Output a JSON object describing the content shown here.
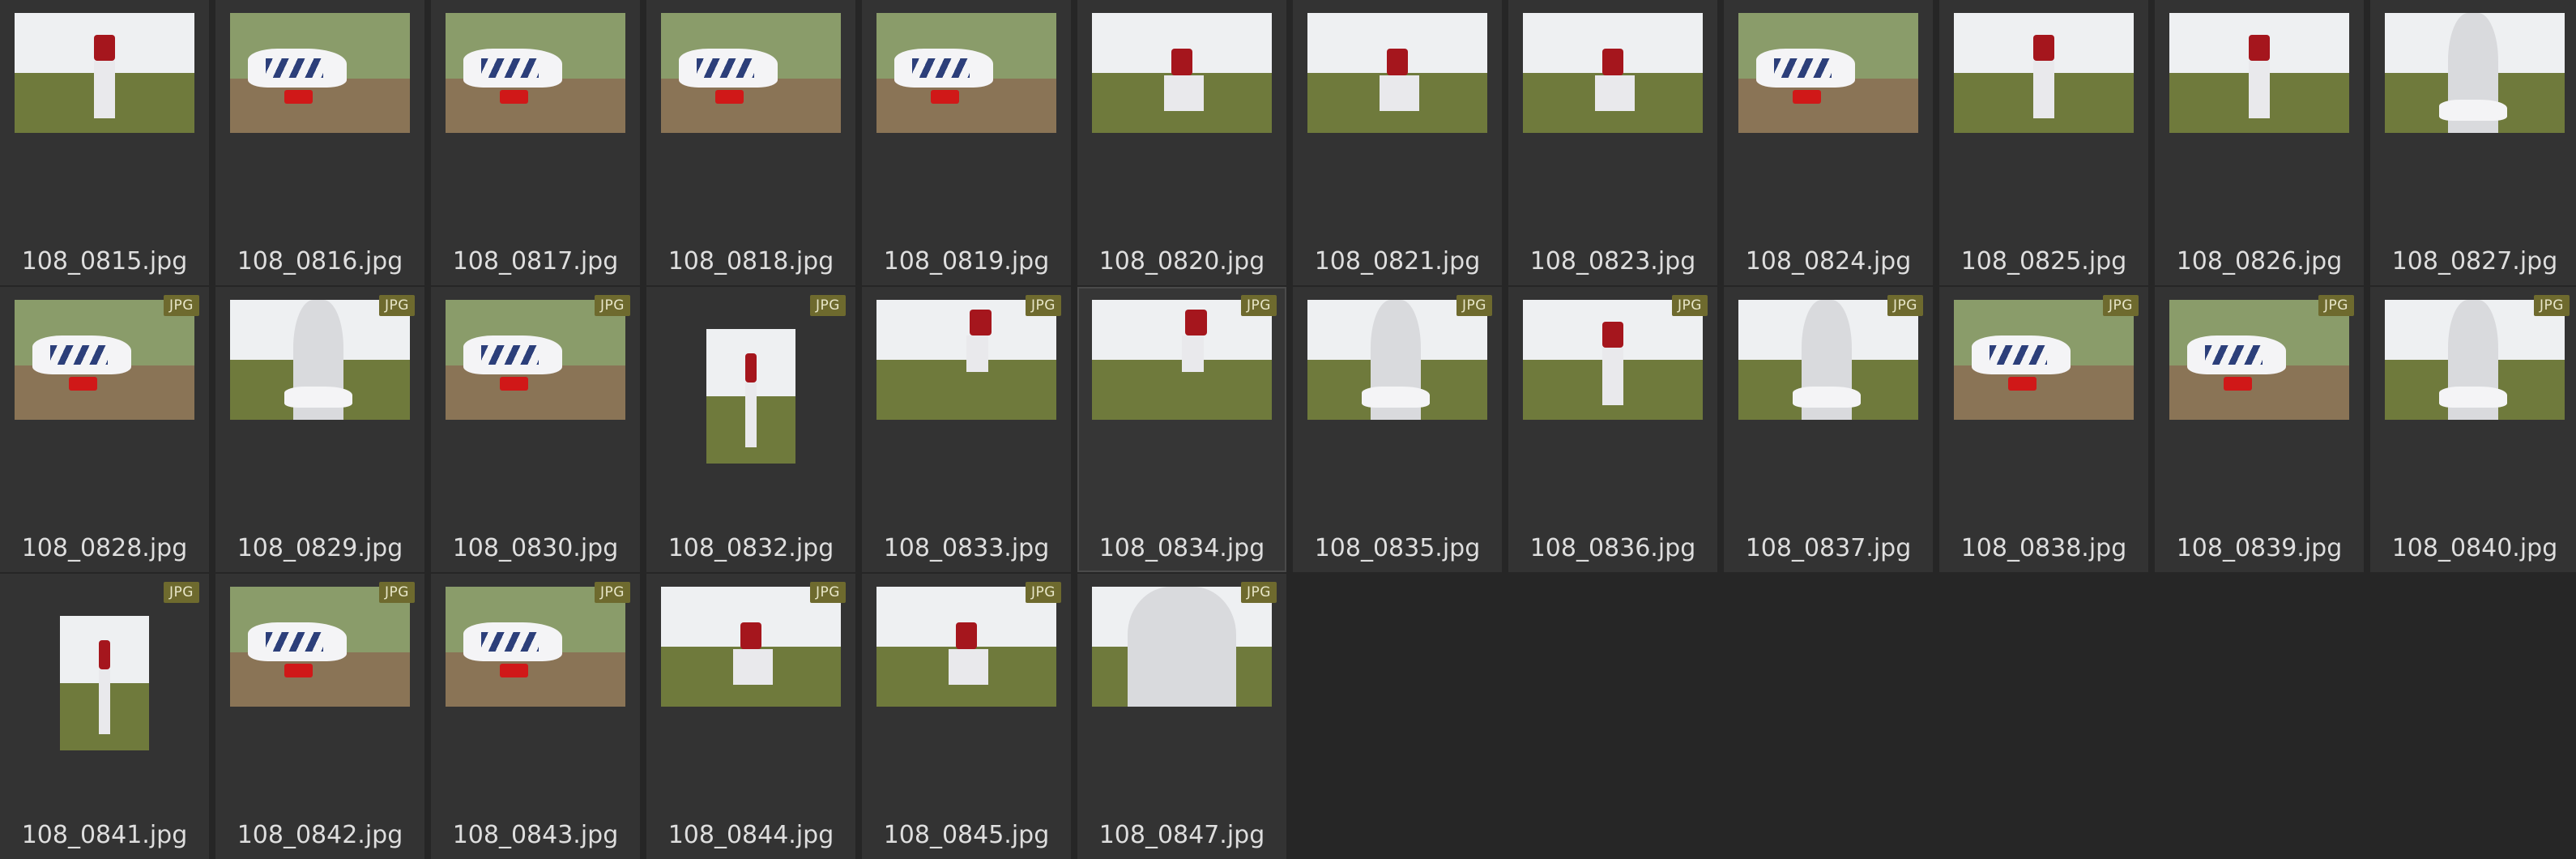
{
  "badge_label": "JPG",
  "files": [
    {
      "name": "108_0815.jpg",
      "scene": "standing",
      "badge": false
    },
    {
      "name": "108_0816.jpg",
      "scene": "shoe",
      "badge": false
    },
    {
      "name": "108_0817.jpg",
      "scene": "shoe",
      "badge": false
    },
    {
      "name": "108_0818.jpg",
      "scene": "shoe",
      "badge": false
    },
    {
      "name": "108_0819.jpg",
      "scene": "shoe",
      "badge": false
    },
    {
      "name": "108_0820.jpg",
      "scene": "crouch",
      "badge": false
    },
    {
      "name": "108_0821.jpg",
      "scene": "crouch",
      "badge": false
    },
    {
      "name": "108_0823.jpg",
      "scene": "crouch",
      "badge": false
    },
    {
      "name": "108_0824.jpg",
      "scene": "shoe",
      "badge": false
    },
    {
      "name": "108_0825.jpg",
      "scene": "standing",
      "badge": false
    },
    {
      "name": "108_0826.jpg",
      "scene": "standing",
      "badge": false
    },
    {
      "name": "108_0827.jpg",
      "scene": "legs",
      "badge": false
    },
    {
      "name": "108_0828.jpg",
      "scene": "shoe",
      "badge": true
    },
    {
      "name": "108_0829.jpg",
      "scene": "legs",
      "badge": true
    },
    {
      "name": "108_0830.jpg",
      "scene": "shoe",
      "badge": true
    },
    {
      "name": "108_0832.jpg",
      "scene": "portrait",
      "badge": true
    },
    {
      "name": "108_0833.jpg",
      "scene": "jump",
      "badge": true
    },
    {
      "name": "108_0834.jpg",
      "scene": "jump",
      "badge": true,
      "selected": true
    },
    {
      "name": "108_0835.jpg",
      "scene": "legs",
      "badge": true
    },
    {
      "name": "108_0836.jpg",
      "scene": "standing",
      "badge": true
    },
    {
      "name": "108_0837.jpg",
      "scene": "legs",
      "badge": true
    },
    {
      "name": "108_0838.jpg",
      "scene": "shoe",
      "badge": true
    },
    {
      "name": "108_0839.jpg",
      "scene": "shoe",
      "badge": true
    },
    {
      "name": "108_0840.jpg",
      "scene": "legs",
      "badge": true
    },
    {
      "name": "108_0841.jpg",
      "scene": "portrait",
      "badge": true
    },
    {
      "name": "108_0842.jpg",
      "scene": "shoe",
      "badge": true
    },
    {
      "name": "108_0843.jpg",
      "scene": "shoe",
      "badge": true
    },
    {
      "name": "108_0844.jpg",
      "scene": "crouch",
      "badge": true
    },
    {
      "name": "108_0845.jpg",
      "scene": "crouch",
      "badge": true
    },
    {
      "name": "108_0847.jpg",
      "scene": "back",
      "badge": true
    }
  ]
}
